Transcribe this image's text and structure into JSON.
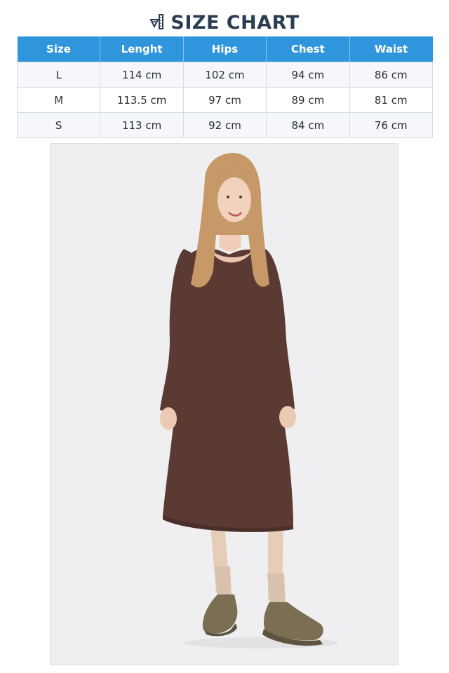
{
  "header": {
    "title": "SIZE CHART",
    "icon": "ruler-pencil-icon"
  },
  "table": {
    "columns": [
      "Size",
      "Lenght",
      "Hips",
      "Chest",
      "Waist"
    ],
    "rows": [
      [
        "L",
        "114 cm",
        "102 cm",
        "94 cm",
        "86 cm"
      ],
      [
        "M",
        "113.5 cm",
        "97 cm",
        "89 cm",
        "81 cm"
      ],
      [
        "S",
        "113 cm",
        "92 cm",
        "84 cm",
        "76 cm"
      ]
    ]
  },
  "colors": {
    "header_bg": "#2f96dd",
    "title": "#2b3d52",
    "dress": "#5b3a33",
    "shoes": "#7a6f53"
  }
}
